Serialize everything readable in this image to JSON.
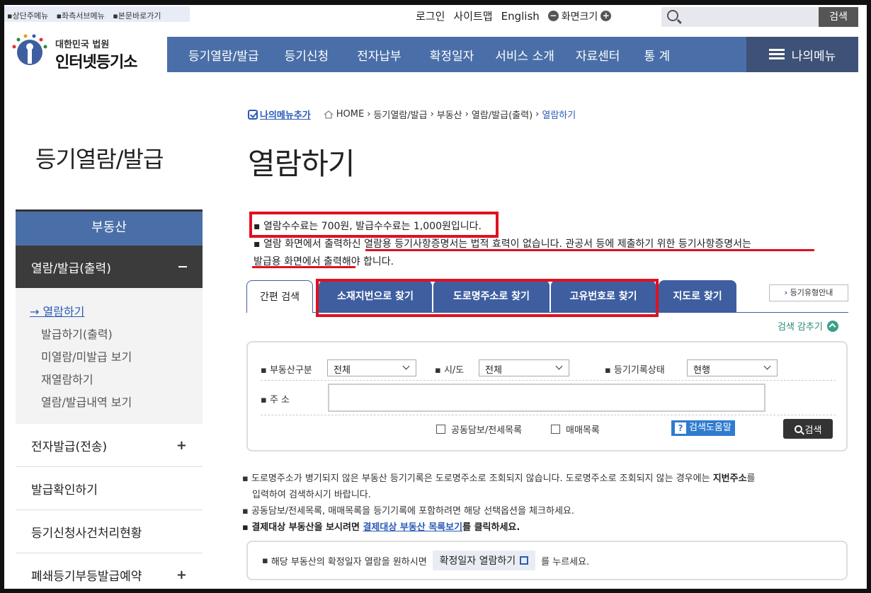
{
  "skip_links": [
    "상단주메뉴",
    "좌측서브메뉴",
    "본문바로가기"
  ],
  "util": {
    "login": "로그인",
    "sitemap": "사이트맵",
    "english": "English",
    "zoom_label": "화면크기",
    "zoom_minus": "−",
    "zoom_plus": "+",
    "search_button": "검색"
  },
  "logo": {
    "line1": "대한민국 법원",
    "line2": "인터넷등기소"
  },
  "gnb": [
    "등기열람/발급",
    "등기신청",
    "전자납부",
    "확정일자",
    "서비스 소개",
    "자료센터",
    "통 계"
  ],
  "my_menu": "나의메뉴",
  "breadcrumb": {
    "add_menu": "나의메뉴추가",
    "items": [
      "HOME",
      "등기열람/발급",
      "부동산",
      "열람/발급(출력)"
    ],
    "current": "열람하기"
  },
  "sidebar": {
    "title": "등기열람/발급",
    "category": "부동산",
    "sub": "열람/발급(출력)",
    "sub_items": [
      "열람하기",
      "발급하기(출력)",
      "미열람/미발급 보기",
      "재열람하기",
      "열람/발급내역 보기"
    ],
    "items": [
      "전자발급(전송)",
      "발급확인하기",
      "등기신청사건처리현황",
      "폐쇄등기부등발급예약"
    ]
  },
  "page_title": "열람하기",
  "notice": {
    "line1": "열람수수료는 700원, 발급수수료는 1,000원입니다.",
    "line2": "열람 화면에서 출력하신 열람용 등기사항증명서는 법적 효력이 없습니다. 관공서 등에 제출하기 위한 등기사항증명서는",
    "line3": "발급용 화면에서 출력해야 합니다."
  },
  "tabs": [
    "간편 검색",
    "소재지번으로 찾기",
    "도로명주소로 찾기",
    "고유번호로 찾기",
    "지도로 찾기"
  ],
  "guide_button": "등기유형안내",
  "collapse_label": "검색 감추기",
  "form": {
    "type_label": "부동산구분",
    "type_value": "전체",
    "sido_label": "시/도",
    "sido_value": "전체",
    "status_label": "등기기록상태",
    "status_value": "현행",
    "addr_label": "주 소",
    "cb1": "공동담보/전세목록",
    "cb2": "매매목록",
    "help": "검색도움말",
    "help_mark": "?",
    "search": "검색"
  },
  "notes": {
    "n1a": "도로명주소가 병기되지 않은 부동산 등기기록은 도로명주소로 조회되지 않습니다. 도로명주소로 조회되지 않는 경우에는 ",
    "n1b": "지번주소",
    "n1c": "를",
    "n1d": "입력하여 검색하시기 바랍니다.",
    "n2": "공동담보/전세목록, 매매목록을 등기기록에 포함하려면 해당 선택옵션을 체크하세요.",
    "n3a": "결제대상 부동산을 보시려면 ",
    "n3b": "결제대상 부동산 목록보기",
    "n3c": "를 클릭하세요."
  },
  "confirm": {
    "pre": "해당 부동산의 확정일자 열람을 원하시면",
    "button": "확정일자 열람하기",
    "post": "를 누르세요."
  },
  "colors": {
    "nav_blue": "#4a6fa8",
    "tab_blue": "#3e5ea0",
    "highlight_red": "#e01020",
    "link_blue": "#2b5bb7"
  }
}
